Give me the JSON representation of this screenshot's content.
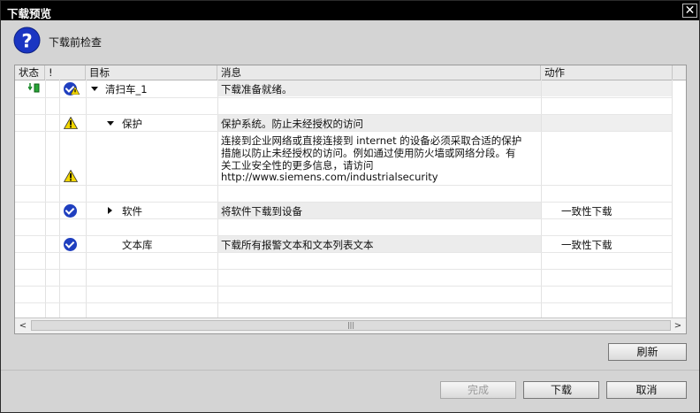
{
  "window": {
    "title": "下载预览",
    "close_glyph": "✕"
  },
  "header": {
    "text": "下载前检查"
  },
  "columns": {
    "status": "状态",
    "flag": "!",
    "target": "目标",
    "message": "消息",
    "action": "动作"
  },
  "rows": {
    "r1": {
      "target": "清扫车_1",
      "message": "下载准备就绪。"
    },
    "r2": {
      "target": "保护",
      "message": "保护系统。防止未经授权的访问"
    },
    "r3": {
      "message_l1": "连接到企业网络或直接连接到 internet 的设备必须采取合适的保护",
      "message_l2": "措施以防止未经授权的访问。例如通过使用防火墙或网络分段。有",
      "message_l3": "关工业安全性的更多信息，请访问",
      "message_l4": "http://www.siemens.com/industrialsecurity"
    },
    "r4": {
      "target": "软件",
      "message": "将软件下载到设备",
      "action": "一致性下载"
    },
    "r5": {
      "target": "文本库",
      "message": "下载所有报警文本和文本列表文本",
      "action": "一致性下载"
    }
  },
  "scrollbar": {
    "left": "<",
    "right": ">",
    "thumb": "|||"
  },
  "buttons": {
    "refresh": "刷新",
    "finish": "完成",
    "download": "下载",
    "cancel": "取消"
  },
  "colors": {
    "check": "#1f3fbf",
    "warning": "#f2d600",
    "titlebar": "#000000"
  }
}
